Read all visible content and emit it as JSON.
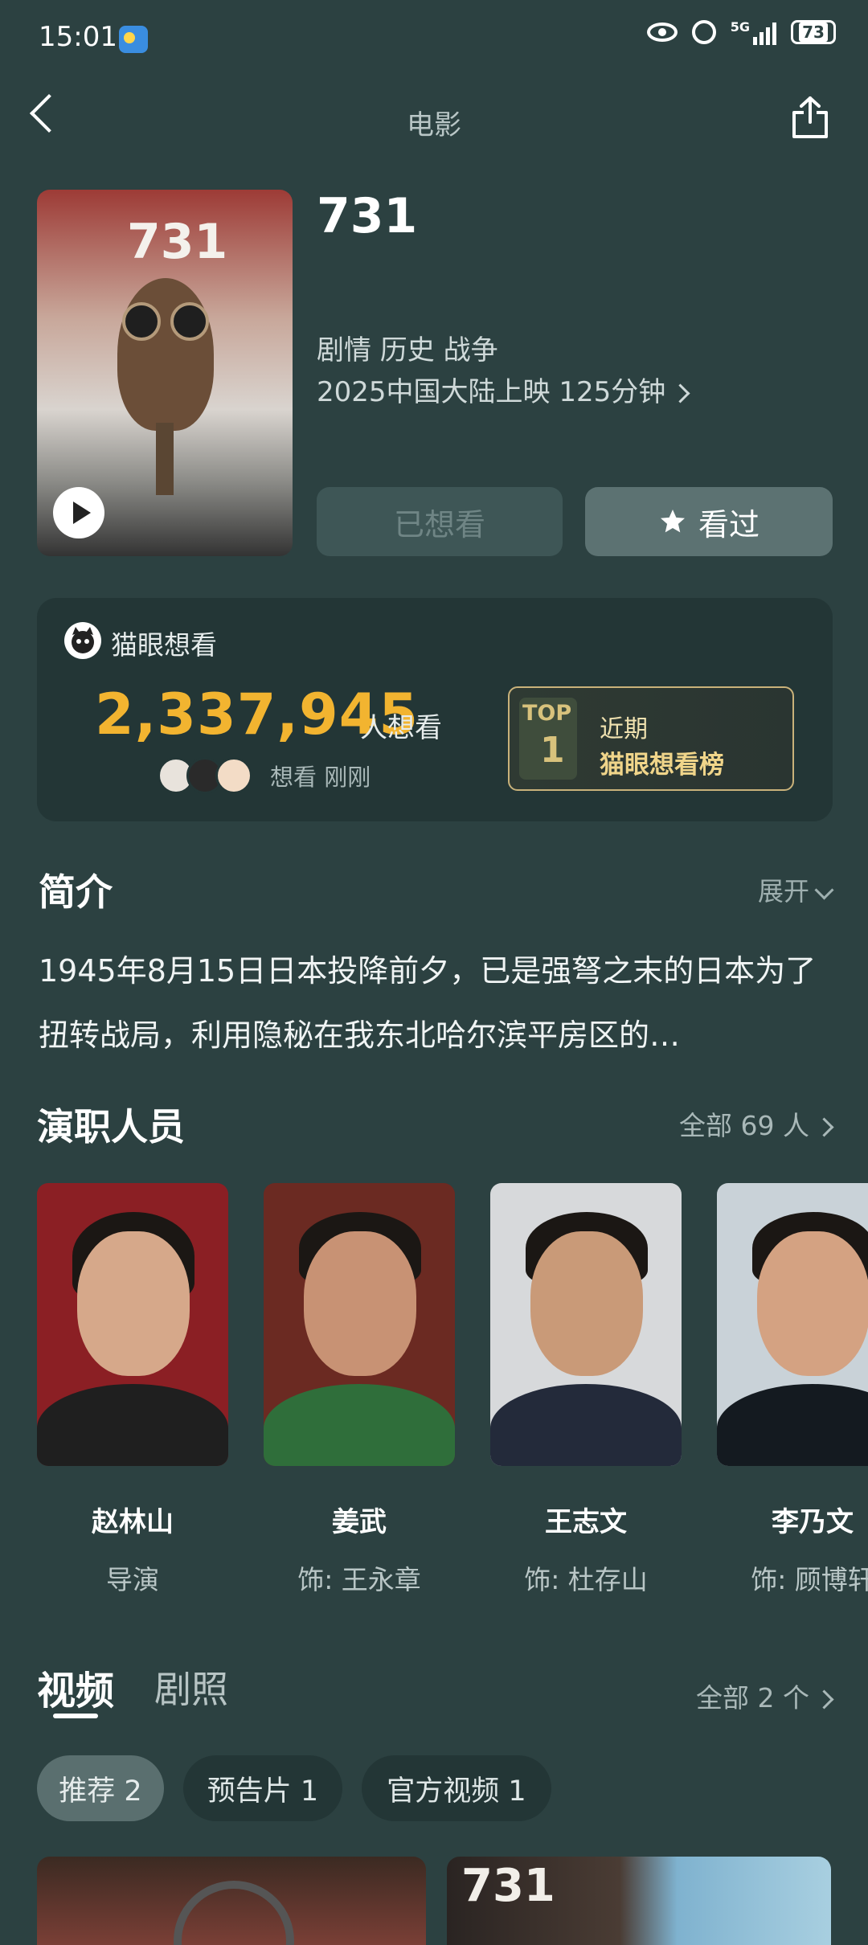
{
  "status": {
    "time": "15:01",
    "network": "5G",
    "battery": "73"
  },
  "nav": {
    "title": "电影"
  },
  "movie": {
    "poster_title": "731",
    "title": "731",
    "genres": "剧情 历史 战争",
    "release": "2025中国大陆上映 125分钟",
    "wish_button": "已想看",
    "seen_button": "看过"
  },
  "maoyan": {
    "label": "猫眼想看",
    "count": "2,337,945",
    "unit": "人想看",
    "recent": "想看  刚刚",
    "top_word": "TOP",
    "top_rank": "1",
    "top_line1": "近期",
    "top_line2": "猫眼想看榜"
  },
  "synopsis": {
    "heading": "简介",
    "expand": "展开",
    "text": "1945年8月15日日本投降前夕，已是强弩之末的日本为了扭转战局，利用隐秘在我东北哈尔滨平房区的…"
  },
  "cast": {
    "heading": "演职人员",
    "all": "全部 69 人",
    "members": [
      {
        "name": "赵林山",
        "role": "导演"
      },
      {
        "name": "姜武",
        "role": "饰: 王永章"
      },
      {
        "name": "王志文",
        "role": "饰: 杜存山"
      },
      {
        "name": "李乃文",
        "role": "饰: 顾博轩"
      }
    ]
  },
  "videos": {
    "tab_video": "视频",
    "tab_photos": "剧照",
    "all": "全部 2 个",
    "chips": [
      "推荐 2",
      "预告片 1",
      "官方视频 1"
    ],
    "thumb_title": "731"
  },
  "colors": {
    "background": "#2c4141",
    "accent": "#f2b430",
    "card": "#233636"
  }
}
